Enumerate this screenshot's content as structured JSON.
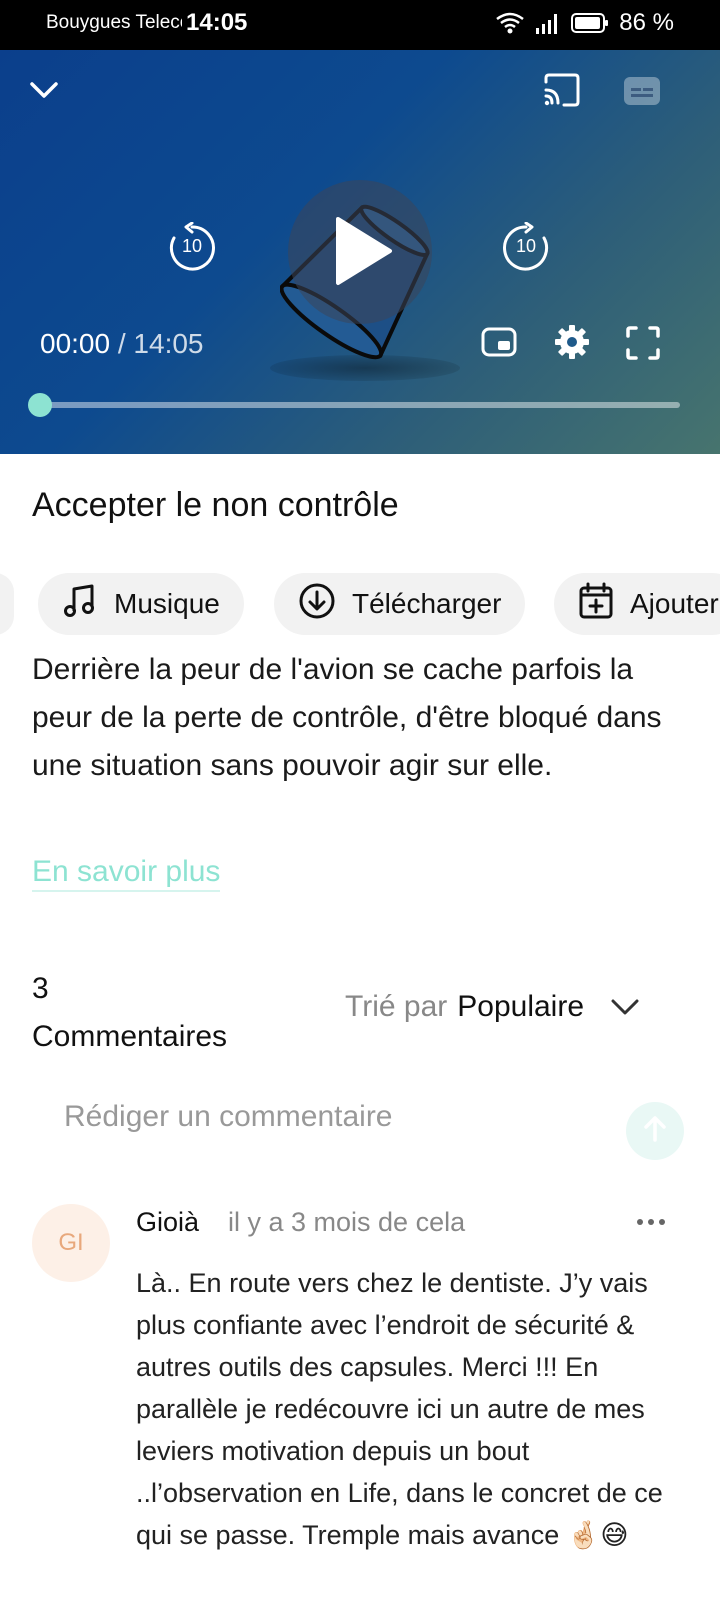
{
  "status_bar": {
    "carrier": "Bouygues Telecom",
    "time": "14:05",
    "battery": "86 %"
  },
  "player": {
    "current_time": "00:00",
    "separator": " / ",
    "duration": "14:05",
    "skip_back_seconds": "10",
    "skip_forward_seconds": "10",
    "progress": 0,
    "accent_color": "#8de3d2"
  },
  "episode": {
    "title": "Accepter le non contrôle",
    "actions": [
      {
        "label": "Musique",
        "icon": "music-note-icon"
      },
      {
        "label": "Télécharger",
        "icon": "download-icon"
      },
      {
        "label": "Ajouter",
        "icon": "calendar-add-icon"
      }
    ],
    "description": "Derrière la peur de l'avion se cache parfois la peur de la perte de contrôle, d'être bloqué dans une situation sans pouvoir agir sur elle.",
    "more_link": "En savoir plus"
  },
  "comments": {
    "count": "3",
    "count_label": "Commentaires",
    "sort_prefix": "Trié par",
    "sort_value": "Populaire",
    "input_placeholder": "Rédiger un commentaire",
    "items": [
      {
        "initials": "GI",
        "author": "Gioià",
        "date": "il y a 3 mois de cela",
        "text": "Là.. En route vers chez le dentiste. J’y vais plus confiante avec l’endroit de sécurité & autres outils des capsules. Merci !!! En parallèle je redécouvre ici un autre de mes leviers motivation depuis un bout ..l’observation en Life, dans le concret de ce qui se passe. Tremple mais avance 🤞🏻😅"
      }
    ]
  }
}
